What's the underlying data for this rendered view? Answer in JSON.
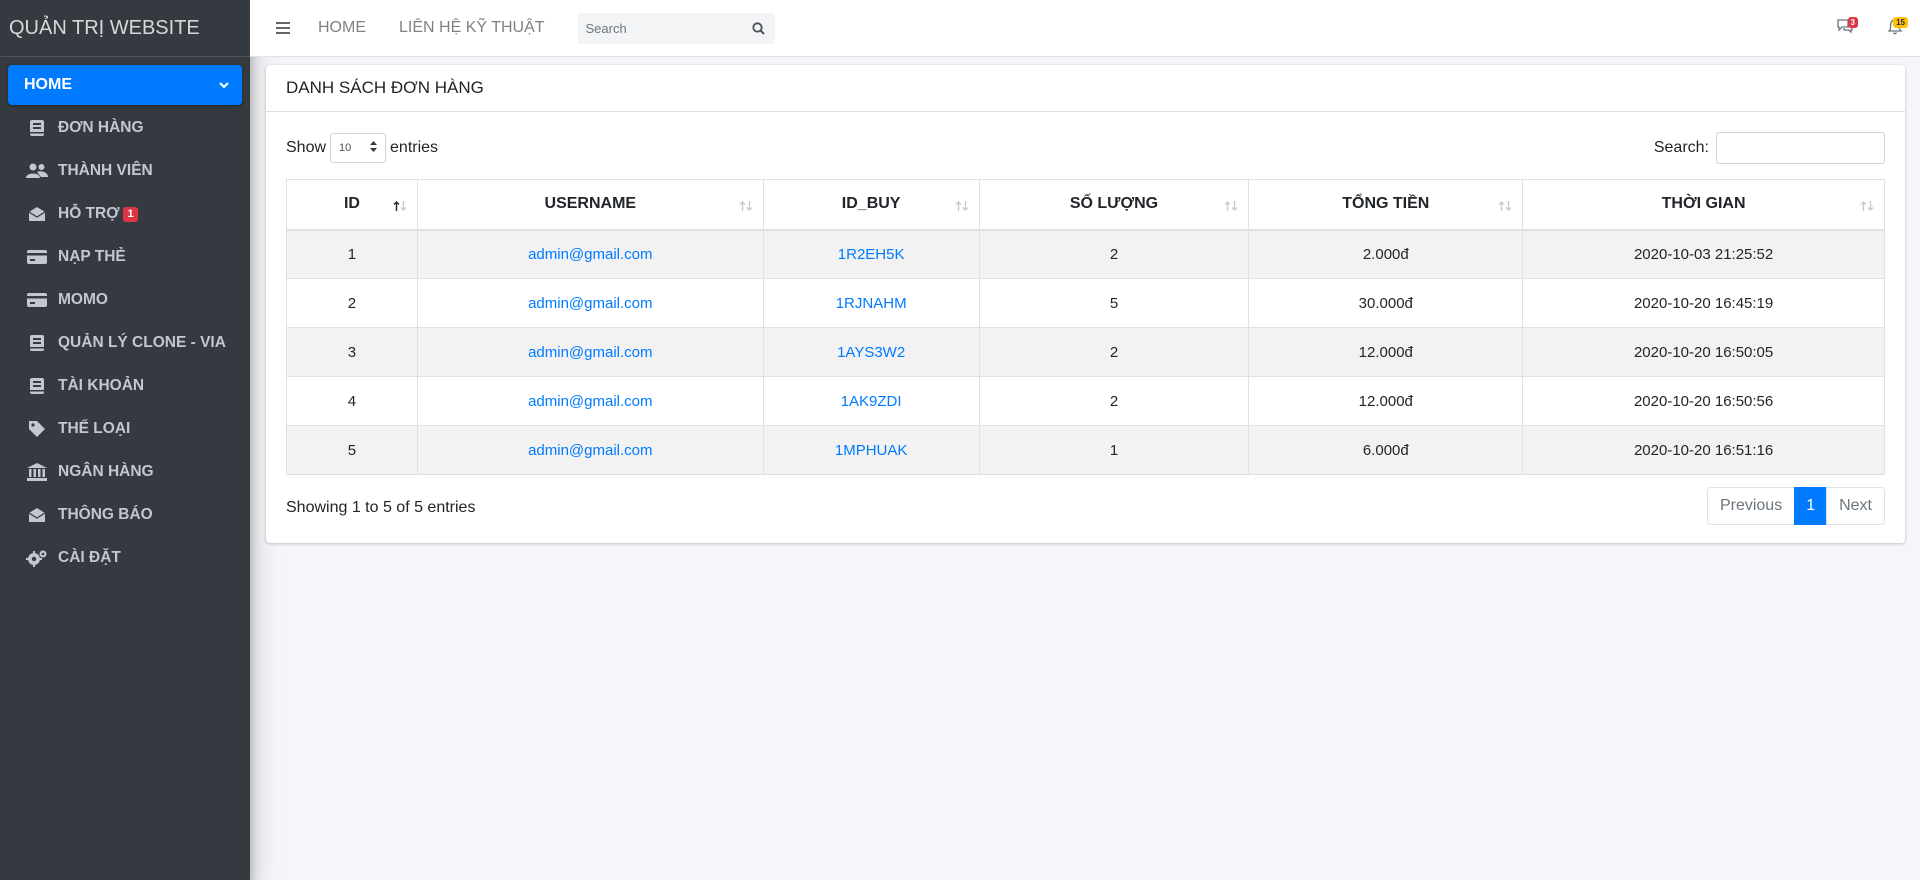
{
  "sidebar": {
    "brand": "QUẢN TRỊ WEBSITE",
    "home_label": "HOME",
    "items": [
      {
        "label": "ĐƠN HÀNG",
        "icon": "book-icon"
      },
      {
        "label": "THÀNH VIÊN",
        "icon": "users-icon"
      },
      {
        "label": "HỖ TRỢ",
        "icon": "envelope-open-icon",
        "badge": "1"
      },
      {
        "label": "NẠP THẺ",
        "icon": "credit-card-icon"
      },
      {
        "label": "MOMO",
        "icon": "credit-card-icon"
      },
      {
        "label": "QUẢN LÝ CLONE - VIA",
        "icon": "book-icon"
      },
      {
        "label": "TÀI KHOẢN",
        "icon": "book-icon"
      },
      {
        "label": "THỂ LOẠI",
        "icon": "tag-icon"
      },
      {
        "label": "NGÂN HÀNG",
        "icon": "bank-icon"
      },
      {
        "label": "THÔNG BÁO",
        "icon": "envelope-open-icon"
      },
      {
        "label": "CÀI ĐẶT",
        "icon": "gears-icon"
      }
    ]
  },
  "topbar": {
    "links": [
      "HOME",
      "LIÊN HỆ KỸ THUẬT"
    ],
    "search_placeholder": "Search",
    "messages_badge": "3",
    "notifications_badge": "15"
  },
  "card": {
    "title": "DANH SÁCH ĐƠN HÀNG",
    "show_label": "Show",
    "entries_value": "10",
    "entries_label": "entries",
    "search_label": "Search:",
    "columns": [
      "ID",
      "USERNAME",
      "ID_BUY",
      "SỐ LƯỢNG",
      "TỔNG TIỀN",
      "THỜI GIAN"
    ],
    "rows": [
      {
        "id": "1",
        "username": "admin@gmail.com",
        "id_buy": "1R2EH5K",
        "qty": "2",
        "total": "2.000đ",
        "time": "2020-10-03 21:25:52"
      },
      {
        "id": "2",
        "username": "admin@gmail.com",
        "id_buy": "1RJNAHM",
        "qty": "5",
        "total": "30.000đ",
        "time": "2020-10-20 16:45:19"
      },
      {
        "id": "3",
        "username": "admin@gmail.com",
        "id_buy": "1AYS3W2",
        "qty": "2",
        "total": "12.000đ",
        "time": "2020-10-20 16:50:05"
      },
      {
        "id": "4",
        "username": "admin@gmail.com",
        "id_buy": "1AK9ZDI",
        "qty": "2",
        "total": "12.000đ",
        "time": "2020-10-20 16:50:56"
      },
      {
        "id": "5",
        "username": "admin@gmail.com",
        "id_buy": "1MPHUAK",
        "qty": "1",
        "total": "6.000đ",
        "time": "2020-10-20 16:51:16"
      }
    ],
    "info": "Showing 1 to 5 of 5 entries",
    "pager": {
      "previous": "Previous",
      "current": "1",
      "next": "Next"
    }
  },
  "colors": {
    "accent": "#007bff",
    "sidebar": "#343a40",
    "danger": "#dc3545",
    "warning": "#ffc107"
  }
}
